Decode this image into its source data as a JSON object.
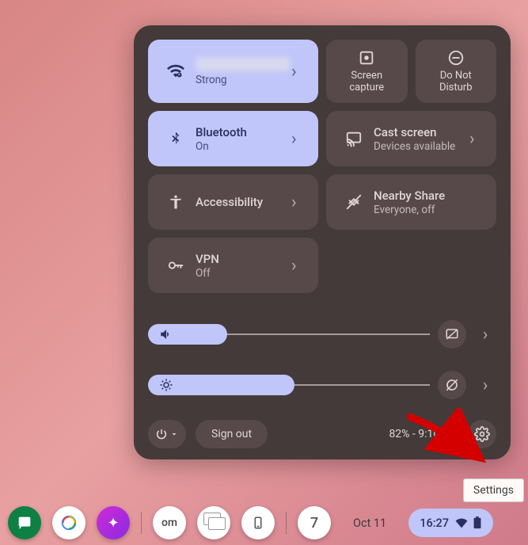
{
  "tiles": {
    "wifi": {
      "label": "",
      "sub": "Strong",
      "on": true
    },
    "screen_capture": {
      "label": "Screen\ncapture"
    },
    "dnd": {
      "label": "Do Not\nDisturb"
    },
    "bluetooth": {
      "label": "Bluetooth",
      "sub": "On",
      "on": true
    },
    "cast": {
      "label": "Cast screen",
      "sub": "Devices available"
    },
    "accessibility": {
      "label": "Accessibility"
    },
    "nearby": {
      "label": "Nearby Share",
      "sub": "Everyone, off"
    },
    "vpn": {
      "label": "VPN",
      "sub": "Off"
    }
  },
  "sliders": {
    "volume_pct": 28,
    "brightness_pct": 52
  },
  "footer": {
    "sign_out": "Sign out",
    "battery_text": "82% - 9:10 left"
  },
  "tooltip": "Settings",
  "shelf": {
    "date": "Oct 11",
    "time": "16:27",
    "notification_count": "7"
  }
}
